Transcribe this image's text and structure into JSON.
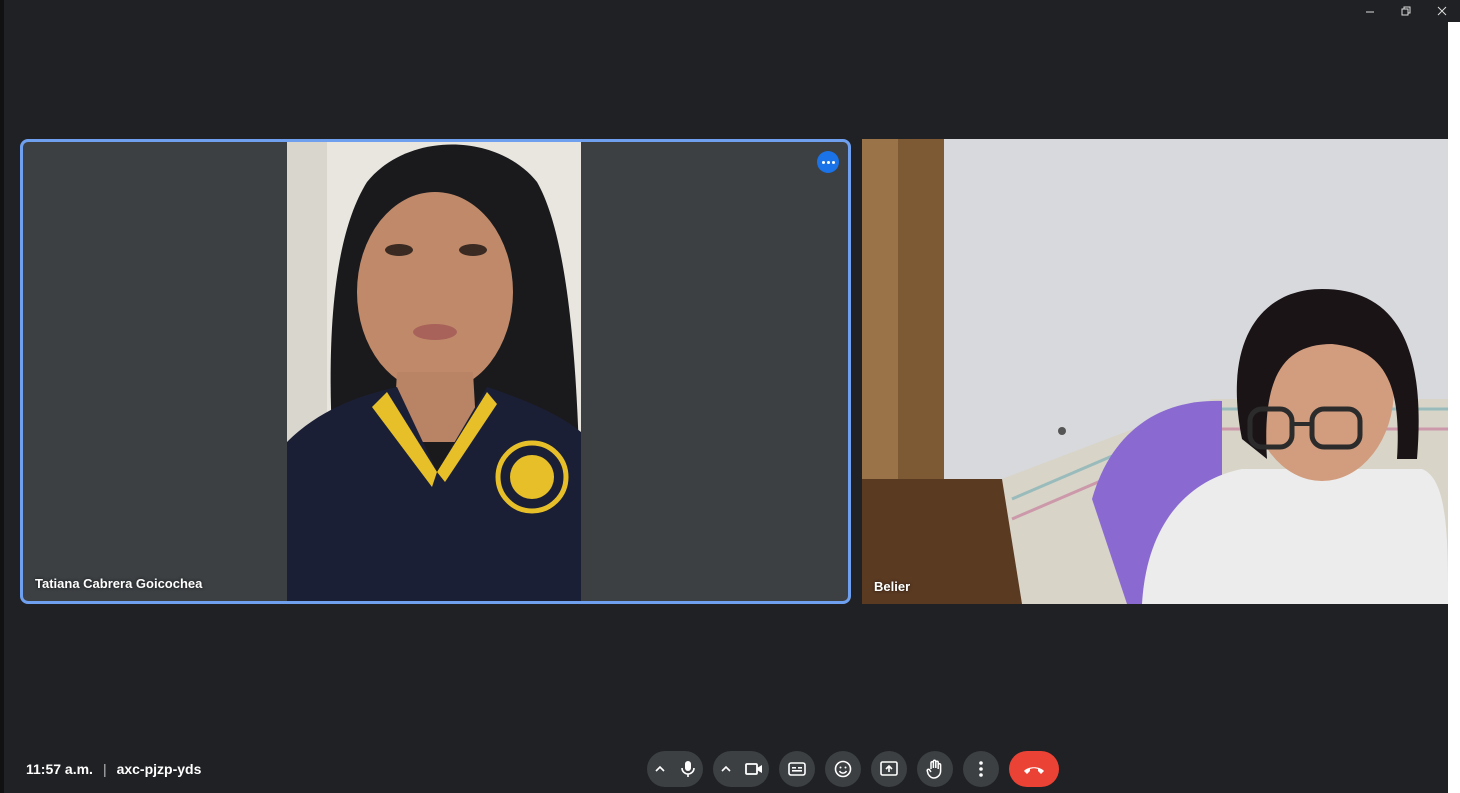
{
  "window": {
    "controls": [
      "minimize-icon",
      "restore-icon",
      "close-icon"
    ]
  },
  "participants": [
    {
      "name": "Tatiana Cabrera Goicochea",
      "active_speaker": true
    },
    {
      "name": "Belier",
      "active_speaker": false
    }
  ],
  "meeting": {
    "time": "11:57 a.m.",
    "separator": "|",
    "code": "axc-pjzp-yds"
  },
  "toolbar": {
    "buttons": [
      "mic-options-chevron-icon",
      "microphone-icon",
      "camera-options-chevron-icon",
      "camera-icon",
      "captions-icon",
      "emoji-icon",
      "present-screen-icon",
      "raise-hand-icon",
      "more-options-icon",
      "end-call-icon"
    ]
  },
  "colors": {
    "background": "#202124",
    "tile": "#3c4043",
    "active_border": "#6fa0f0",
    "end_call": "#ea4335",
    "accent": "#1a73e8"
  }
}
